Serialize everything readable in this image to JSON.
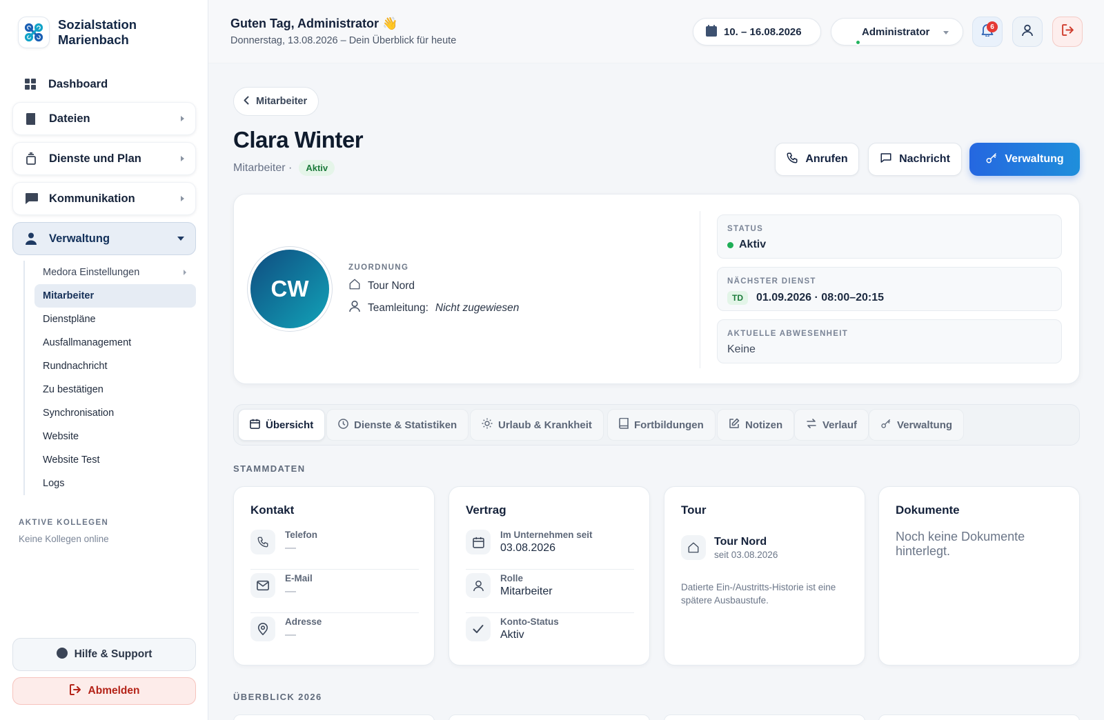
{
  "brand": {
    "name_line1": "Sozialstation",
    "name_line2": "Marienbach"
  },
  "sidebar": {
    "items": [
      {
        "label": "Dashboard",
        "icon": "grid-icon"
      },
      {
        "label": "Dateien",
        "icon": "file-icon"
      },
      {
        "label": "Dienste und Plan",
        "icon": "calendar-stack-icon"
      },
      {
        "label": "Kommunikation",
        "icon": "chat-icon"
      },
      {
        "label": "Verwaltung",
        "icon": "person-icon"
      }
    ],
    "sub_items": [
      "Medora Einstellungen",
      "Mitarbeiter",
      "Dienstpläne",
      "Ausfallmanagement",
      "Rundnachricht",
      "Zu bestätigen",
      "Synchronisation",
      "Website",
      "Website Test",
      "Logs"
    ],
    "active_sub": "Mitarbeiter",
    "colleagues_title": "AKTIVE KOLLEGEN",
    "colleagues_text": "Keine Kollegen online",
    "help_label": "Hilfe & Support",
    "logout_label": "Abmelden"
  },
  "header": {
    "greeting": "Guten Tag, Administrator 👋",
    "subline": "Donnerstag, 13.08.2026 – Dein Überblick für heute",
    "date_range": "10. – 16.08.2026",
    "user_name": "Administrator",
    "notification_count": "6"
  },
  "profile": {
    "back_label": "Mitarbeiter",
    "name": "Clara Winter",
    "role": "Mitarbeiter ·",
    "status_badge": "Aktiv",
    "initials": "CW",
    "actions": {
      "call": "Anrufen",
      "message": "Nachricht",
      "admin": "Verwaltung"
    },
    "assignment_label": "ZUORDNUNG",
    "tour": "Tour Nord",
    "team_lead_label": "Teamleitung:",
    "team_lead_value": "Nicht zugewiesen",
    "status_label": "STATUS",
    "status_value": "Aktiv",
    "next_shift_label": "NÄCHSTER DIENST",
    "next_shift_code": "TD",
    "next_shift_value": "01.09.2026 · 08:00–20:15",
    "absence_label": "AKTUELLE ABWESENHEIT",
    "absence_value": "Keine"
  },
  "tabs": [
    "Übersicht",
    "Dienste & Statistiken",
    "Urlaub & Krankheit",
    "Fortbildungen",
    "Notizen",
    "Verlauf",
    "Verwaltung"
  ],
  "stammdaten": {
    "title": "STAMMDATEN",
    "kontakt": {
      "title": "Kontakt",
      "phone_label": "Telefon",
      "phone": "—",
      "email_label": "E-Mail",
      "email": "—",
      "address_label": "Adresse",
      "address": "—"
    },
    "vertrag": {
      "title": "Vertrag",
      "since_label": "Im Unternehmen seit",
      "since": "03.08.2026",
      "role_label": "Rolle",
      "role": "Mitarbeiter",
      "account_label": "Konto-Status",
      "account": "Aktiv"
    },
    "tour": {
      "title": "Tour",
      "name": "Tour Nord",
      "since": "seit 03.08.2026",
      "note": "Datierte Ein-/Austritts-Historie ist eine spätere Ausbaustufe."
    },
    "dokumente": {
      "title": "Dokumente",
      "empty": "Noch keine Dokumente hinterlegt."
    }
  },
  "overview_title": "ÜBERBLICK 2026"
}
